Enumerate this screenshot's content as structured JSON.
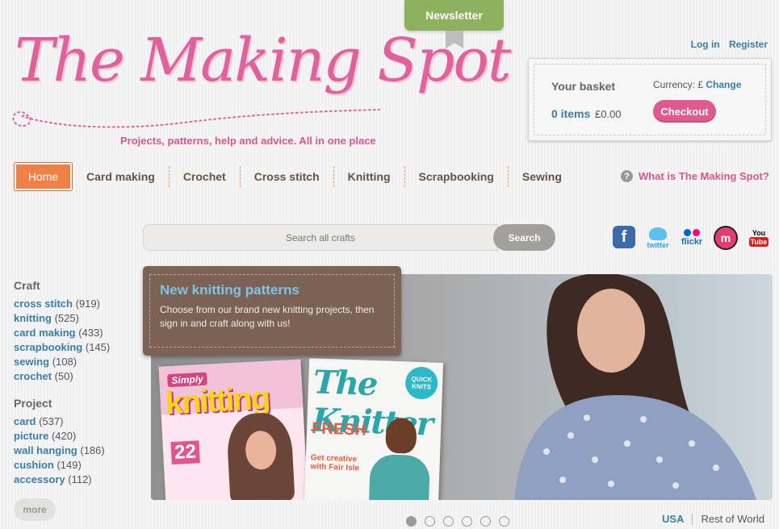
{
  "header": {
    "newsletter_label": "Newsletter",
    "logo_text": "The Making Spot",
    "tagline": "Projects, patterns, help and advice. All in one place",
    "login_label": "Log in",
    "register_label": "Register"
  },
  "basket": {
    "title": "Your basket",
    "items": "0 items",
    "total": "£0.00",
    "currency_label": "Currency: £",
    "change_label": "Change",
    "checkout_label": "Checkout"
  },
  "nav": {
    "home": "Home",
    "items": [
      "Card making",
      "Crochet",
      "Cross stitch",
      "Knitting",
      "Scrapbooking",
      "Sewing"
    ],
    "what_is": "What is The Making Spot?",
    "help_glyph": "?"
  },
  "search": {
    "placeholder": "Search all crafts",
    "button_label": "Search"
  },
  "social": {
    "facebook": "f",
    "twitter": "twitter",
    "flickr": "flickr",
    "myspace": "m",
    "youtube_you": "You",
    "youtube_tube": "Tube"
  },
  "sidebar": {
    "craft_heading": "Craft",
    "craft_items": [
      {
        "label": "cross stitch",
        "count": "(919)"
      },
      {
        "label": "knitting",
        "count": "(525)"
      },
      {
        "label": "card making",
        "count": "(433)"
      },
      {
        "label": "scrapbooking",
        "count": "(145)"
      },
      {
        "label": "sewing",
        "count": "(108)"
      },
      {
        "label": "crochet",
        "count": "(50)"
      }
    ],
    "project_heading": "Project",
    "project_items": [
      {
        "label": "card",
        "count": "(537)"
      },
      {
        "label": "picture",
        "count": "(420)"
      },
      {
        "label": "wall hanging",
        "count": "(186)"
      },
      {
        "label": "cushion",
        "count": "(149)"
      },
      {
        "label": "accessory",
        "count": "(112)"
      }
    ],
    "more_label": "more"
  },
  "hero": {
    "title": "New knitting patterns",
    "text": "Choose from our brand new knitting projects, then sign in and craft along with us!",
    "mag1_simply": "Simply",
    "mag1_title": "knitting",
    "mag1_22": "22",
    "mag2_title": "The Knitter",
    "mag2_badge": "QUICK KNITS",
    "mag2_fresh": "FRESH",
    "mag2_fair": "Get creative with Fair Isle",
    "slide_count": 6,
    "active_slide": 1
  },
  "region": {
    "usa": "USA",
    "rest": "Rest of World"
  },
  "colors": {
    "pink": "#e05a8f",
    "orange": "#ef8146",
    "green": "#8db05f",
    "link_blue": "#3a7ea6",
    "brown": "#7b6254"
  }
}
